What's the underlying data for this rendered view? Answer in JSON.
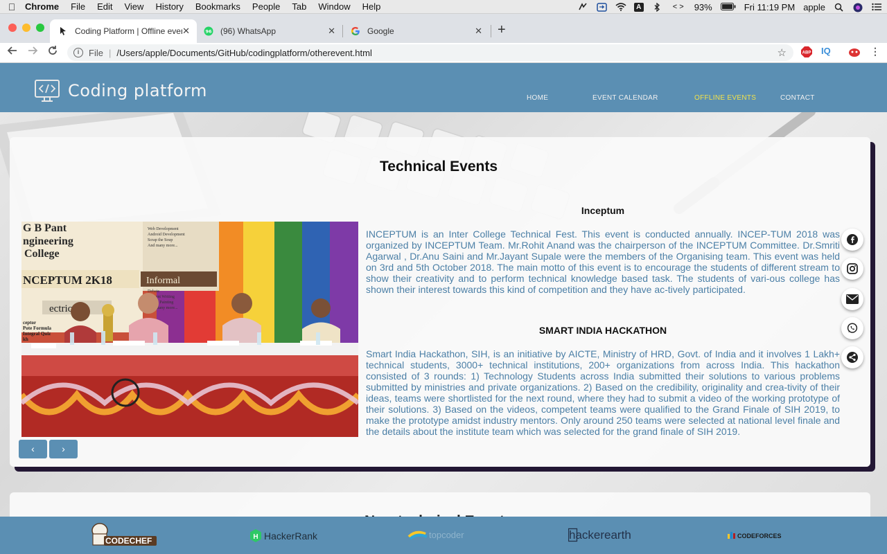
{
  "menubar": {
    "app": "Chrome",
    "items": [
      "File",
      "Edit",
      "View",
      "History",
      "Bookmarks",
      "People",
      "Tab",
      "Window",
      "Help"
    ],
    "battery": "93%",
    "clock": "Fri 11:19 PM",
    "user": "apple",
    "status_icons": [
      "dnd-icon",
      "screen-share-icon",
      "wifi-icon",
      "input-source-icon",
      "bluetooth-icon",
      "dev-tools-icon",
      "battery-icon",
      "search-icon",
      "siri-icon",
      "notification-center-icon"
    ],
    "input_source_label": "A"
  },
  "tabs": [
    {
      "title": "Coding Platform | Offline event",
      "icon": "page-favicon"
    },
    {
      "title": "(96) WhatsApp",
      "icon": "whatsapp-favicon",
      "badge": "96"
    },
    {
      "title": "Google",
      "icon": "google-favicon"
    }
  ],
  "address": {
    "scheme_label": "File",
    "url": "/Users/apple/Documents/GitHub/codingplatform/otherevent.html"
  },
  "extensions": [
    "ABP",
    "IQ"
  ],
  "site": {
    "logo_text": "Coding platform",
    "nav": [
      {
        "label": "HOME",
        "active": false
      },
      {
        "label": "EVENT CALENDAR",
        "active": false
      },
      {
        "label": "OFFLINE EVENTS",
        "active": true
      },
      {
        "label": "CONTACT",
        "active": false
      }
    ],
    "accent_color": "#5b8fb3",
    "active_nav_color": "#f3e24a",
    "text_color": "#4b7fa6"
  },
  "section": {
    "title": "Technical Events",
    "carousel": {
      "prev_label": "‹",
      "next_label": "›",
      "slide": {
        "banner_lines": [
          "G B Pant",
          "ngineering",
          "College"
        ],
        "event_board": "NCEPTUM 2K18",
        "informal_board": "Informal",
        "board_list": [
          "Web Development",
          "Android Development",
          "Scrap the Soup",
          "And many more..."
        ],
        "board_list2": [
          "Debate",
          "Content Writing",
          "T-shirt Painting",
          "And many more..."
        ],
        "sign_left": "ectrical",
        "side_text": [
          "ceptor",
          "Pote Formula",
          "Integral Quiz",
          "kh"
        ]
      }
    },
    "events": [
      {
        "title": "Inceptum",
        "text": "INCEPTUM is an Inter College Technical Fest. This event is conducted annually. INCEP-TUM 2018 was organized by INCEPTUM Team. Mr.Rohit Anand was the chairperson of the INCEPTUM Committee. Dr.Smriti Agarwal , Dr.Anu Saini and Mr.Jayant Supale were the members of the Organising team. This event was held on 3rd and 5th October 2018. The main motto of this event is to encourage the students of different stream to show their creativity and to perform technical knowledge based task. The students of vari-ous college has shown their interest towards this kind of competition and they have ac-tively participated."
      },
      {
        "title": "SMART INDIA HACKATHON",
        "text": "Smart India Hackathon, SIH, is an initiative by AICTE, Ministry of HRD, Govt. of India and it involves 1 Lakh+ technical students, 3000+ technical institutions, 200+ organizations from across India. This hackathon consisted of 3 rounds: 1) Technology Students across India submitted their solutions to various problems submitted by ministries and private organizations. 2) Based on the credibility, originality and crea-tivity of their ideas, teams were shortlisted for the next round, where they had to submit a video of the working prototype of their solutions. 3) Based on the videos, competent teams were qualified to the Grand Finale of SIH 2019, to make the prototype amidst industry mentors. Only around 250 teams were selected at national level finale and the details about the institute team which was selected for the grand finale of SIH 2019."
      }
    ],
    "next_section_peek": "Non-technical Events"
  },
  "social": [
    "facebook-icon",
    "instagram-icon",
    "email-icon",
    "whatsapp-icon",
    "share-icon"
  ],
  "sponsors": [
    {
      "name": "CODECHEF",
      "icon": "codechef-logo"
    },
    {
      "name": "HackerRank",
      "icon": "hackerrank-logo"
    },
    {
      "name": "topcoder",
      "icon": "topcoder-logo"
    },
    {
      "name": "hackerearth",
      "icon": "hackerearth-logo"
    },
    {
      "name": "CODEFORCES",
      "icon": "codeforces-logo"
    }
  ]
}
